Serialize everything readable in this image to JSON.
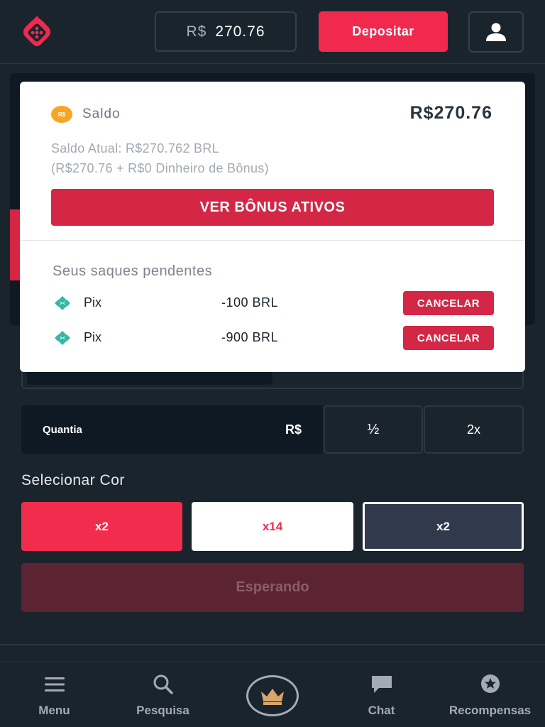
{
  "header": {
    "logo_icon": "dice-logo-icon",
    "balance_currency": "R$",
    "balance_amount": "270.76",
    "deposit_label": "Depositar",
    "user_icon": "user-icon"
  },
  "dropdown": {
    "saldo": {
      "coin_text": "R$",
      "label": "Saldo",
      "amount": "R$270.76",
      "current_line": "Saldo Atual: R$270.762 BRL",
      "detail_line": "(R$270.76 + R$0 Dinheiro de Bônus)"
    },
    "bonus_button_label": "VER BÔNUS ATIVOS",
    "pending": {
      "title": "Seus saques pendentes",
      "items": [
        {
          "method": "Pix",
          "amount": "-100 BRL",
          "action": "CANCELAR",
          "icon": "pix-icon"
        },
        {
          "method": "Pix",
          "amount": "-900 BRL",
          "action": "CANCELAR",
          "icon": "pix-icon"
        }
      ]
    }
  },
  "bet": {
    "amount_label": "Quantia",
    "amount_currency": "R$",
    "half_label": "½",
    "double_label": "2x",
    "select_color_title": "Selecionar Cor",
    "colors": [
      {
        "label": "x2",
        "color": "#f12c4c"
      },
      {
        "label": "x14",
        "color": "#ffffff"
      },
      {
        "label": "x2",
        "color": "#31394d"
      }
    ],
    "status_button_label": "Esperando"
  },
  "nav": {
    "items": [
      {
        "label": "Menu",
        "icon": "menu-icon"
      },
      {
        "label": "Pesquisa",
        "icon": "search-icon"
      },
      {
        "label": "",
        "icon": "crown-icon"
      },
      {
        "label": "Chat",
        "icon": "chat-icon"
      },
      {
        "label": "Recompensas",
        "icon": "rewards-icon"
      }
    ]
  },
  "colors": {
    "background": "#1a242d",
    "accent": "#f2294e",
    "button_red": "#d42745"
  }
}
